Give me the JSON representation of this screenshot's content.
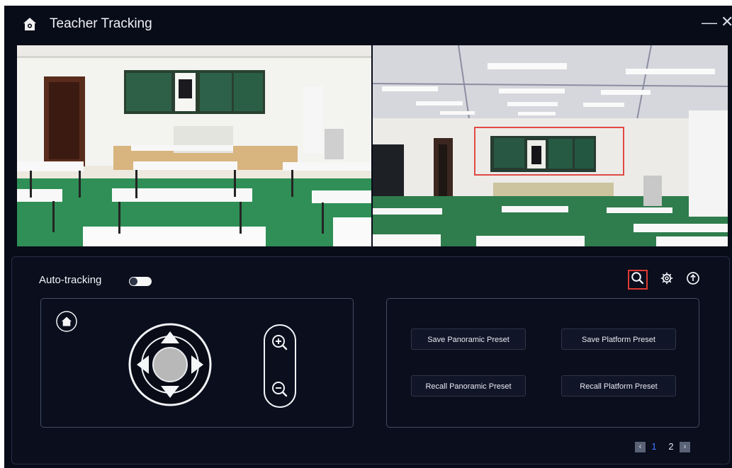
{
  "app": {
    "title": "Teacher Tracking",
    "minimize_glyph": "—",
    "close_glyph": "✕",
    "icons": {
      "home": "home-icon",
      "search": "search-icon",
      "settings": "gear-icon",
      "upload": "upload-arrow-icon"
    },
    "colors": {
      "background": "#080b18",
      "accent_selected": "#e03a32",
      "pager_active": "#3b78ff"
    }
  },
  "controls": {
    "auto_tracking_label": "Auto-tracking",
    "auto_tracking_enabled": false
  },
  "presets": {
    "save_panoramic": "Save Panoramic Preset",
    "save_platform": "Save Platform Preset",
    "recall_panoramic": "Recall Panoramic Preset",
    "recall_platform": "Recall Platform Preset"
  },
  "pagination": {
    "prev": "‹",
    "next": "›",
    "pages": [
      "1",
      "2"
    ],
    "current": "1"
  }
}
